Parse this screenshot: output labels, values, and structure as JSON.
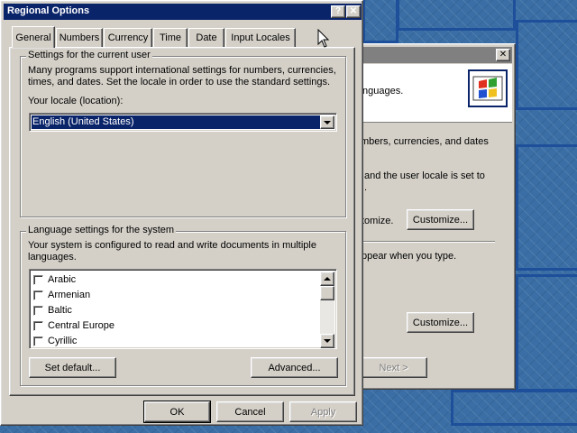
{
  "main_dialog": {
    "title": "Regional Options",
    "help_button": "?",
    "close_button": "✕",
    "tabs": [
      "General",
      "Numbers",
      "Currency",
      "Time",
      "Date",
      "Input Locales"
    ],
    "active_tab": "General",
    "user_group": {
      "legend": "Settings for the current user",
      "description_line1": "Many programs support international settings for numbers, currencies,",
      "description_line2": "times, and dates. Set the locale in order to use the standard settings.",
      "locale_label": "Your locale (location):",
      "locale_value": "English (United States)"
    },
    "language_group": {
      "legend": "Language settings for the system",
      "description_line1": "Your system is configured to read and write documents in multiple",
      "description_line2": "languages.",
      "languages": [
        "Arabic",
        "Armenian",
        "Baltic",
        "Central Europe",
        "Cyrillic"
      ],
      "set_default_button": "Set default...",
      "advanced_button": "Advanced..."
    },
    "ok_button": "OK",
    "cancel_button": "Cancel",
    "apply_button": "Apply"
  },
  "background_dialog": {
    "close_button": "✕",
    "text_languages": "nguages.",
    "text_numbers": "mbers, currencies, and dates",
    "text_locale_line1": "and the user locale is set to",
    "text_locale_line2": ".",
    "text_customize": "tomize.",
    "customize_button_1": "Customize...",
    "text_appear": "ppear when you type.",
    "customize_button_2": "Customize...",
    "next_button": "Next >"
  },
  "colors": {
    "desktop": "#3a6ea5",
    "active_titlebar": "#0a246a",
    "inactive_titlebar": "#808080",
    "face": "#d4d0c8",
    "selection": "#0a246a"
  }
}
